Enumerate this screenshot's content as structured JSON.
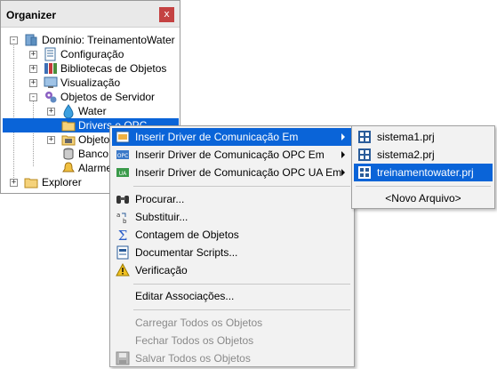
{
  "organizer": {
    "title": "Organizer",
    "close_glyph": "x",
    "tree": [
      {
        "label": "Domínio: TreinamentoWater",
        "expander": "-",
        "icon": "domain-icon"
      },
      {
        "label": "Configuração",
        "expander": "+",
        "icon": "config-icon"
      },
      {
        "label": "Bibliotecas de Objetos",
        "expander": "+",
        "icon": "library-icon"
      },
      {
        "label": "Visualização",
        "expander": "+",
        "icon": "display-icon"
      },
      {
        "label": "Objetos de Servidor",
        "expander": "-",
        "icon": "gears-icon"
      },
      {
        "label": "Water",
        "expander": "+",
        "icon": "water-drop-icon"
      },
      {
        "label": "Drivers e OPC",
        "expander": "",
        "icon": "folder-icon"
      },
      {
        "label": "Objetos",
        "expander": "+",
        "icon": "database-folder-icon"
      },
      {
        "label": "Banco d",
        "expander": "",
        "icon": "database-icon"
      },
      {
        "label": "Alarmes",
        "expander": "",
        "icon": "alarm-icon"
      },
      {
        "label": "Explorer",
        "expander": "+",
        "icon": "folder-icon"
      }
    ]
  },
  "context_menu": {
    "items": [
      {
        "label": "Inserir Driver de Comunicação Em",
        "icon": "driver-icon",
        "submenu": true
      },
      {
        "label": "Inserir Driver de Comunicação OPC Em",
        "icon": "opc-icon",
        "submenu": true
      },
      {
        "label": "Inserir Driver de Comunicação OPC UA Em",
        "icon": "opc-ua-icon",
        "submenu": true
      },
      {
        "label": "Procurar...",
        "icon": "binoculars-icon"
      },
      {
        "label": "Substituir...",
        "icon": "replace-icon"
      },
      {
        "label": "Contagem de Objetos",
        "icon": "sigma-icon"
      },
      {
        "label": "Documentar Scripts...",
        "icon": "document-scripts-icon"
      },
      {
        "label": "Verificação",
        "icon": "warning-icon"
      },
      {
        "label": "Editar Associações...",
        "icon": ""
      },
      {
        "label": "Carregar Todos os Objetos",
        "icon": "",
        "disabled": true
      },
      {
        "label": "Fechar Todos os Objetos",
        "icon": "",
        "disabled": true
      },
      {
        "label": "Salvar Todos os Objetos",
        "icon": "save-icon",
        "disabled": true
      }
    ]
  },
  "submenu": {
    "items": [
      {
        "label": "sistema1.prj",
        "icon": "project-icon"
      },
      {
        "label": "sistema2.prj",
        "icon": "project-icon"
      },
      {
        "label": "treinamentowater.prj",
        "icon": "project-icon"
      },
      {
        "label": "<Novo Arquivo>",
        "icon": ""
      }
    ]
  },
  "colors": {
    "highlight": "#0a64d8",
    "close_button": "#c44242"
  }
}
